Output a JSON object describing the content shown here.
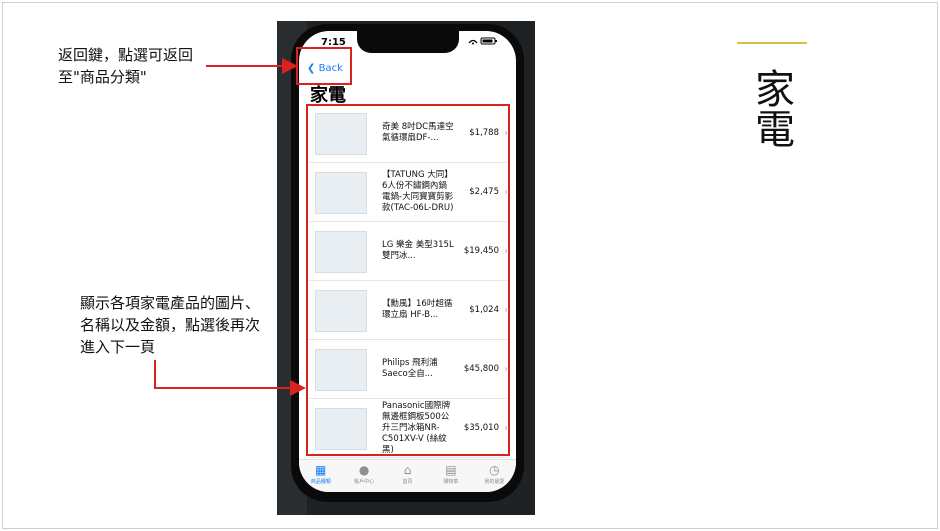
{
  "annotations": {
    "back_note": "返回鍵，點選可返回至\"商品分類\"",
    "list_note": "顯示各項家電產品的圖片、名稱以及金額，點選後再次進入下一頁"
  },
  "side_title": "家電",
  "phone": {
    "status_time": "7:15",
    "back_label": "Back",
    "page_title": "家電",
    "products": [
      {
        "name": "奇美 8吋DC馬達空氣循環扇DF-...",
        "price": "$1,788"
      },
      {
        "name": "【TATUNG 大同】6人份不鏽鋼內鍋電鍋-大同寶寶剪影款(TAC-06L-DRU)",
        "price": "$2,475"
      },
      {
        "name": "LG 樂金 美型315L雙門冰...",
        "price": "$19,450"
      },
      {
        "name": "【勳風】16吋超循環立扇 HF-B...",
        "price": "$1,024"
      },
      {
        "name": "Philips 飛利浦 Saeco全自...",
        "price": "$45,800"
      },
      {
        "name": "Panasonic國際牌 無邊框鋼板500公升三門冰箱NR-C501XV-V (絲紋黑)",
        "price": "$35,010"
      }
    ],
    "tabs": [
      {
        "label": "商品種類"
      },
      {
        "label": "帳戶中心"
      },
      {
        "label": "首頁"
      },
      {
        "label": "購物車"
      },
      {
        "label": "我的最愛"
      }
    ]
  },
  "colors": {
    "accent": "#1a7cf0",
    "annotation_red": "#d9231e",
    "side_line": "#d9c043"
  }
}
